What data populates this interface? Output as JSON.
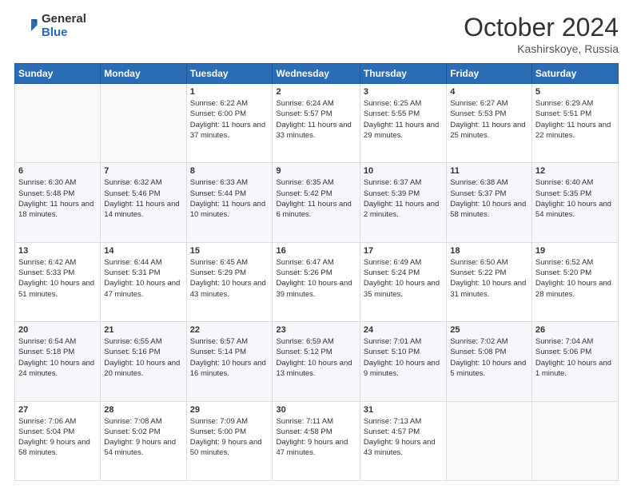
{
  "logo": {
    "general": "General",
    "blue": "Blue"
  },
  "header": {
    "month": "October 2024",
    "location": "Kashirskoye, Russia"
  },
  "weekdays": [
    "Sunday",
    "Monday",
    "Tuesday",
    "Wednesday",
    "Thursday",
    "Friday",
    "Saturday"
  ],
  "weeks": [
    [
      {
        "day": "",
        "info": ""
      },
      {
        "day": "",
        "info": ""
      },
      {
        "day": "1",
        "info": "Sunrise: 6:22 AM\nSunset: 6:00 PM\nDaylight: 11 hours and 37 minutes."
      },
      {
        "day": "2",
        "info": "Sunrise: 6:24 AM\nSunset: 5:57 PM\nDaylight: 11 hours and 33 minutes."
      },
      {
        "day": "3",
        "info": "Sunrise: 6:25 AM\nSunset: 5:55 PM\nDaylight: 11 hours and 29 minutes."
      },
      {
        "day": "4",
        "info": "Sunrise: 6:27 AM\nSunset: 5:53 PM\nDaylight: 11 hours and 25 minutes."
      },
      {
        "day": "5",
        "info": "Sunrise: 6:29 AM\nSunset: 5:51 PM\nDaylight: 11 hours and 22 minutes."
      }
    ],
    [
      {
        "day": "6",
        "info": "Sunrise: 6:30 AM\nSunset: 5:48 PM\nDaylight: 11 hours and 18 minutes."
      },
      {
        "day": "7",
        "info": "Sunrise: 6:32 AM\nSunset: 5:46 PM\nDaylight: 11 hours and 14 minutes."
      },
      {
        "day": "8",
        "info": "Sunrise: 6:33 AM\nSunset: 5:44 PM\nDaylight: 11 hours and 10 minutes."
      },
      {
        "day": "9",
        "info": "Sunrise: 6:35 AM\nSunset: 5:42 PM\nDaylight: 11 hours and 6 minutes."
      },
      {
        "day": "10",
        "info": "Sunrise: 6:37 AM\nSunset: 5:39 PM\nDaylight: 11 hours and 2 minutes."
      },
      {
        "day": "11",
        "info": "Sunrise: 6:38 AM\nSunset: 5:37 PM\nDaylight: 10 hours and 58 minutes."
      },
      {
        "day": "12",
        "info": "Sunrise: 6:40 AM\nSunset: 5:35 PM\nDaylight: 10 hours and 54 minutes."
      }
    ],
    [
      {
        "day": "13",
        "info": "Sunrise: 6:42 AM\nSunset: 5:33 PM\nDaylight: 10 hours and 51 minutes."
      },
      {
        "day": "14",
        "info": "Sunrise: 6:44 AM\nSunset: 5:31 PM\nDaylight: 10 hours and 47 minutes."
      },
      {
        "day": "15",
        "info": "Sunrise: 6:45 AM\nSunset: 5:29 PM\nDaylight: 10 hours and 43 minutes."
      },
      {
        "day": "16",
        "info": "Sunrise: 6:47 AM\nSunset: 5:26 PM\nDaylight: 10 hours and 39 minutes."
      },
      {
        "day": "17",
        "info": "Sunrise: 6:49 AM\nSunset: 5:24 PM\nDaylight: 10 hours and 35 minutes."
      },
      {
        "day": "18",
        "info": "Sunrise: 6:50 AM\nSunset: 5:22 PM\nDaylight: 10 hours and 31 minutes."
      },
      {
        "day": "19",
        "info": "Sunrise: 6:52 AM\nSunset: 5:20 PM\nDaylight: 10 hours and 28 minutes."
      }
    ],
    [
      {
        "day": "20",
        "info": "Sunrise: 6:54 AM\nSunset: 5:18 PM\nDaylight: 10 hours and 24 minutes."
      },
      {
        "day": "21",
        "info": "Sunrise: 6:55 AM\nSunset: 5:16 PM\nDaylight: 10 hours and 20 minutes."
      },
      {
        "day": "22",
        "info": "Sunrise: 6:57 AM\nSunset: 5:14 PM\nDaylight: 10 hours and 16 minutes."
      },
      {
        "day": "23",
        "info": "Sunrise: 6:59 AM\nSunset: 5:12 PM\nDaylight: 10 hours and 13 minutes."
      },
      {
        "day": "24",
        "info": "Sunrise: 7:01 AM\nSunset: 5:10 PM\nDaylight: 10 hours and 9 minutes."
      },
      {
        "day": "25",
        "info": "Sunrise: 7:02 AM\nSunset: 5:08 PM\nDaylight: 10 hours and 5 minutes."
      },
      {
        "day": "26",
        "info": "Sunrise: 7:04 AM\nSunset: 5:06 PM\nDaylight: 10 hours and 1 minute."
      }
    ],
    [
      {
        "day": "27",
        "info": "Sunrise: 7:06 AM\nSunset: 5:04 PM\nDaylight: 9 hours and 58 minutes."
      },
      {
        "day": "28",
        "info": "Sunrise: 7:08 AM\nSunset: 5:02 PM\nDaylight: 9 hours and 54 minutes."
      },
      {
        "day": "29",
        "info": "Sunrise: 7:09 AM\nSunset: 5:00 PM\nDaylight: 9 hours and 50 minutes."
      },
      {
        "day": "30",
        "info": "Sunrise: 7:11 AM\nSunset: 4:58 PM\nDaylight: 9 hours and 47 minutes."
      },
      {
        "day": "31",
        "info": "Sunrise: 7:13 AM\nSunset: 4:57 PM\nDaylight: 9 hours and 43 minutes."
      },
      {
        "day": "",
        "info": ""
      },
      {
        "day": "",
        "info": ""
      }
    ]
  ]
}
